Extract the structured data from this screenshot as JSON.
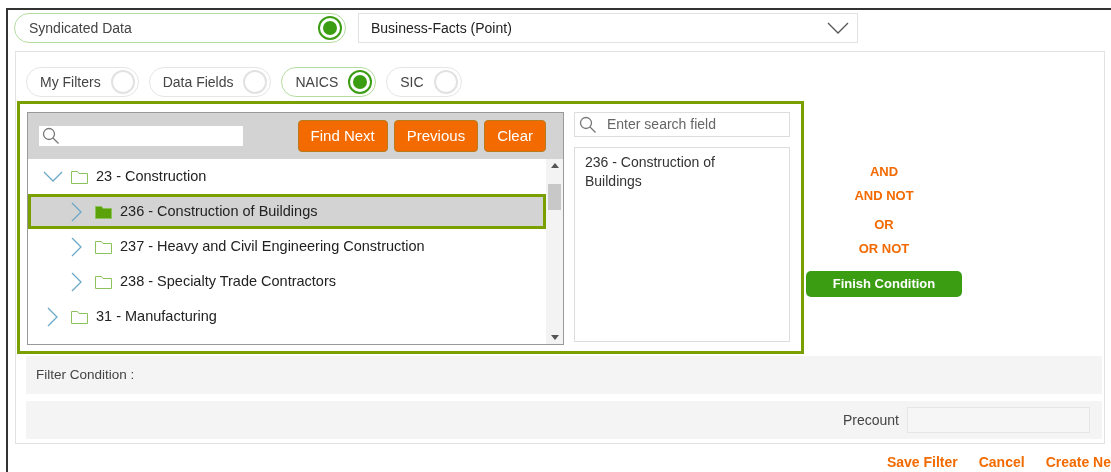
{
  "source": {
    "label": "Syndicated Data",
    "selected": true
  },
  "dataset": {
    "value": "Business-Facts (Point)"
  },
  "filter_types": [
    {
      "label": "My Filters",
      "selected": false
    },
    {
      "label": "Data Fields",
      "selected": false
    },
    {
      "label": "NAICS",
      "selected": true
    },
    {
      "label": "SIC",
      "selected": false
    }
  ],
  "tree_buttons": [
    "Find Next",
    "Previous",
    "Clear"
  ],
  "tree": [
    {
      "label": "23 - Construction",
      "expanded": true,
      "selected": false,
      "children": [
        {
          "label": "236 - Construction of Buildings",
          "expanded": false,
          "selected": true
        },
        {
          "label": "237 - Heavy and Civil Engineering Construction",
          "expanded": false,
          "selected": false
        },
        {
          "label": "238 - Specialty Trade Contractors",
          "expanded": false,
          "selected": false
        }
      ]
    },
    {
      "label": "31 - Manufacturing",
      "expanded": false,
      "selected": false
    }
  ],
  "selected_search": {
    "placeholder": "Enter search field"
  },
  "selected_values": [
    "236 - Construction of Buildings"
  ],
  "operators": [
    "AND",
    "AND NOT",
    "OR",
    "OR NOT"
  ],
  "finish_button": "Finish Condition",
  "filter_condition": {
    "label": "Filter Condition :"
  },
  "precount": {
    "label": "Precount"
  },
  "actions": [
    "Save Filter",
    "Cancel",
    "Create Ne"
  ]
}
